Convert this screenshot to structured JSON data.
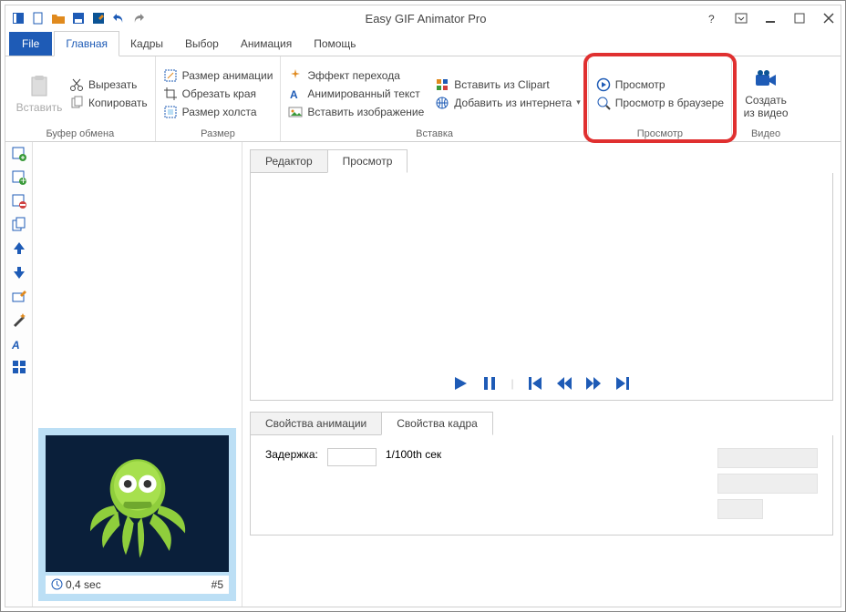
{
  "app_title": "Easy GIF Animator Pro",
  "file_tab": "File",
  "ribbon_tabs": [
    "Главная",
    "Кадры",
    "Выбор",
    "Анимация",
    "Помощь"
  ],
  "ribbon": {
    "clipboard": {
      "label": "Буфер обмена",
      "paste": "Вставить",
      "cut": "Вырезать",
      "copy": "Копировать"
    },
    "size": {
      "label": "Размер",
      "anim_size": "Размер анимации",
      "crop": "Обрезать края",
      "canvas_size": "Размер холста"
    },
    "insert": {
      "label": "Вставка",
      "transition": "Эффект перехода",
      "anim_text": "Анимированный текст",
      "insert_image": "Вставить изображение",
      "clipart": "Вставить из Clipart",
      "internet": "Добавить из интернета"
    },
    "preview": {
      "label": "Просмотр",
      "preview_btn": "Просмотр",
      "browser_btn": "Просмотр в браузере"
    },
    "video": {
      "label": "Видео",
      "create": "Создать из видео"
    }
  },
  "main_tabs": {
    "editor": "Редактор",
    "preview": "Просмотр"
  },
  "props_tabs": {
    "anim": "Свойства анимации",
    "frame": "Свойства кадра"
  },
  "frame": {
    "duration": "0,4 sec",
    "number": "#5"
  },
  "delay": {
    "label": "Задержка:",
    "value": "",
    "unit": "1/100th сек"
  }
}
